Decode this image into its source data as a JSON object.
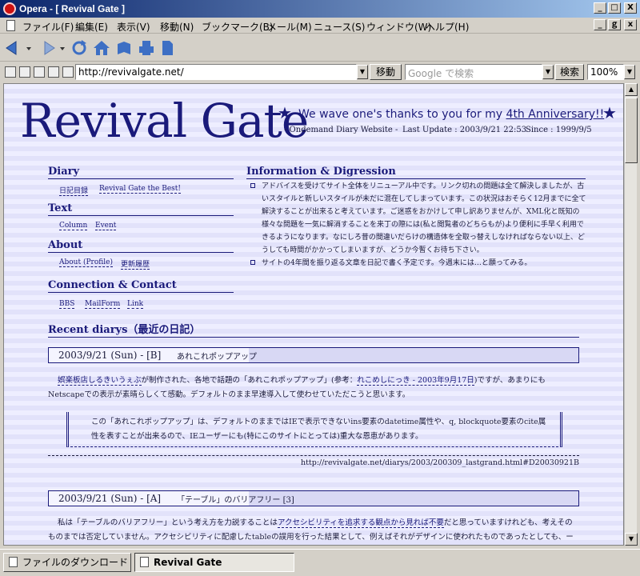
{
  "window": {
    "title": "Opera - [ Revival Gate ]",
    "minimize": "_",
    "maximize": "□",
    "close": "X",
    "restore": "ｇ",
    "close_small": "x"
  },
  "menu": {
    "items": [
      {
        "label": "ファイル(F)"
      },
      {
        "label": "編集(E)"
      },
      {
        "label": "表示(V)"
      },
      {
        "label": "移動(N)"
      },
      {
        "label": "ブックマーク(B)"
      },
      {
        "label": "メール(M)"
      },
      {
        "label": "ニュース(S)"
      },
      {
        "label": "ウィンドウ(W)"
      },
      {
        "label": "ヘルプ(H)"
      }
    ]
  },
  "addressbar": {
    "url": "http://revivalgate.net/",
    "go_label": "移動",
    "search_placeholder": "Google で検索",
    "search_label": "検索",
    "zoom": "100%"
  },
  "page": {
    "logo": "Revival Gate",
    "star": "★",
    "thanks_prefix": "We wave one's thanks to you for my ",
    "thanks_link": "4th Anniversary!!",
    "tagline": "- Ondemand Diary Website -",
    "last_update": "Last Update : 2003/9/21 22:53",
    "since": "Since : 1999/9/5",
    "sections": {
      "diary": {
        "title": "Diary",
        "links": [
          "日記目録",
          "Revival Gate the Best!"
        ]
      },
      "text": {
        "title": "Text",
        "links": [
          "Column",
          "Event"
        ]
      },
      "about": {
        "title": "About",
        "links": [
          "About (Profile)",
          "更新履歴"
        ]
      },
      "connection": {
        "title": "Connection & Contact",
        "links": [
          "BBS",
          "MailForm",
          "Link"
        ]
      }
    },
    "info": {
      "title": "Information & Digression",
      "items": [
        "アドバイスを受けてサイト全体をリニューアル中です。リンク切れの問題は全て解決しましたが、古いスタイルと新しいスタイルが未だに混在してしまっています。この状況はおそらく12月までに全て解決することが出来ると考えています。ご迷惑をおかけして申し訳ありませんが、XML化と既知の様々な問題を一気に解消することを来丁の際には(私と閲覧者のどちらもが)より便利に手早く利用できるようになります。なにしろ昔の間違いだらけの構造体を全取っ替えしなければならない以上、どうしても時間がかかってしまいますが、どうか今暫くお待ち下さい。",
        "サイトの4年間を振り返る文章を日記で書く予定です。今週末には…と願ってみる。"
      ]
    },
    "recent": {
      "title": "Recent diarys（最近の日記）",
      "entries": [
        {
          "date": "2003/9/21 (Sun) - [B]",
          "title": "あれこれポップアップ",
          "link1": "娯楽板店しるきいうぇぶ",
          "text1": "が制作された、各地で話題の「あれこれポップアップ」(参考：",
          "link2": "れこめしにっき - 2003年9月17日",
          "text2": ")ですが、あまりにもNetscapeでの表示が素晴らしくて感動。デフォルトのまま早速導入して使わせていただこうと思います。",
          "quote": "この「あれこれポップアップ」は、デフォルトのままではIEで表示できないins要素のdatetime属性や、q, blockquote要素のcite属性を表すことが出来るので、IEユーザーにも(特にこのサイトにとっては)重大な恩恵があります。",
          "permalink": "http://revivalgate.net/diarys/2003/200309_lastgrand.html#D20030921B"
        },
        {
          "date": "2003/9/21 (Sun) - [A]",
          "title": "「テーブル」のバリアフリー [3]",
          "text1": "私は「テーブルのバリアフリー」という考え方を力説することは",
          "link1": "アクセシビリティを追求する観点から見れば不要",
          "text2": "だと思っていますけれども、考えそのものまでは否定していません。アクセシビリティに配慮したtableの誤用を行った結果として、例えばそれがデザインに使われたものであったとしても、ー"
        }
      ]
    }
  },
  "tabs": [
    {
      "label": "ファイルのダウンロード"
    },
    {
      "label": "Revival Gate"
    }
  ]
}
